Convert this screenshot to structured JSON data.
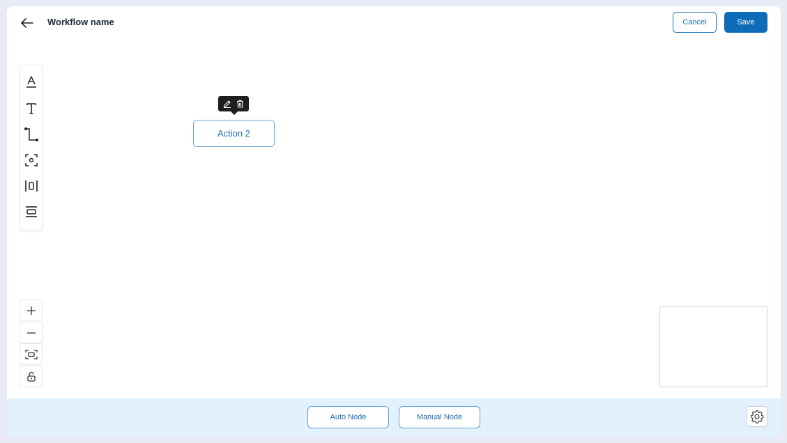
{
  "header": {
    "title": "Workflow name",
    "cancel_label": "Cancel",
    "save_label": "Save"
  },
  "toolbar": {
    "tools": [
      {
        "icon": "text-underline-icon"
      },
      {
        "icon": "text-icon"
      },
      {
        "icon": "connector-icon"
      },
      {
        "icon": "focus-icon"
      },
      {
        "icon": "align-horizontal-center-icon"
      },
      {
        "icon": "align-vertical-center-icon"
      }
    ]
  },
  "zoom": {
    "buttons": [
      {
        "icon": "plus-icon"
      },
      {
        "icon": "minus-icon"
      },
      {
        "icon": "fit-view-icon"
      },
      {
        "icon": "lock-icon"
      }
    ]
  },
  "canvas": {
    "node_label": "Action 2",
    "node_toolbar": [
      {
        "icon": "edit-icon"
      },
      {
        "icon": "trash-icon"
      }
    ]
  },
  "footer": {
    "auto_node_label": "Auto Node",
    "manual_node_label": "Manual Node",
    "settings_icon": "gear-icon"
  },
  "colors": {
    "primary": "#0d6bb8",
    "footer_bg": "#e3f1fc",
    "outer_bg": "#e8eaf6"
  }
}
